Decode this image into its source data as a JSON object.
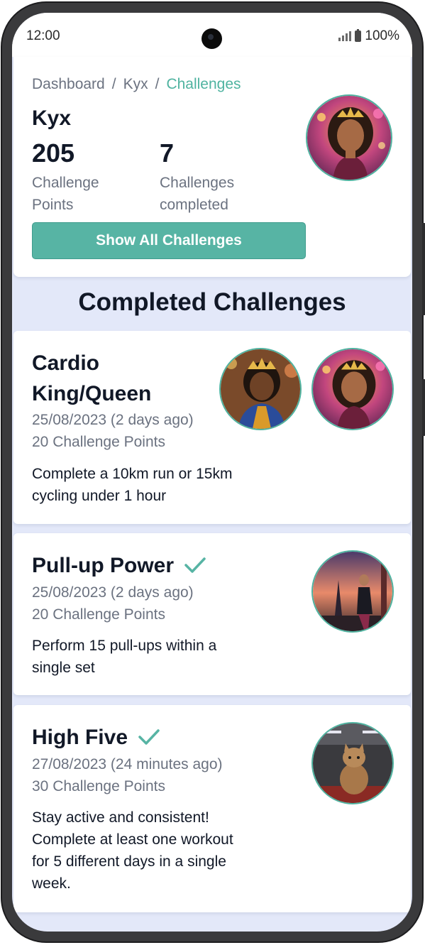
{
  "status_bar": {
    "time": "12:00",
    "battery": "100%"
  },
  "breadcrumb": {
    "items": [
      "Dashboard",
      "Kyx",
      "Challenges"
    ],
    "separator": "/"
  },
  "profile": {
    "name": "Kyx",
    "points_value": "205",
    "points_label_1": "Challenge",
    "points_label_2": "Points",
    "completed_value": "7",
    "completed_label_1": "Challenges",
    "completed_label_2": "completed"
  },
  "show_all_button": "Show All Challenges",
  "section_title": "Completed Challenges",
  "challenges": [
    {
      "title_line1": "Cardio",
      "title_line2": "King/Queen",
      "date": "25/08/2023 (2 days ago)",
      "points": "20 Challenge Points",
      "desc_line1": "Complete a 10km run or 15km",
      "desc_line2": "cycling under 1 hour",
      "completed_check": false
    },
    {
      "title_line1": "Pull-up Power",
      "date": "25/08/2023 (2 days ago)",
      "points": "20 Challenge Points",
      "desc_line1": "Perform 15 pull-ups within a",
      "desc_line2": "single set",
      "completed_check": true
    },
    {
      "title_line1": "High Five",
      "date": "27/08/2023 (24 minutes ago)",
      "points": "30 Challenge Points",
      "desc_line1": "Stay active and consistent!",
      "desc_line2": "Complete at least one workout",
      "desc_line3": "for 5 different days in a single",
      "desc_line4": "week.",
      "completed_check": true
    }
  ],
  "colors": {
    "accent": "#57b4a4",
    "section_bg": "#e3e8f9",
    "text": "#111827",
    "muted": "#6b7280"
  },
  "icons": [
    "check-icon",
    "signal-icon",
    "battery-icon",
    "camera-icon"
  ]
}
